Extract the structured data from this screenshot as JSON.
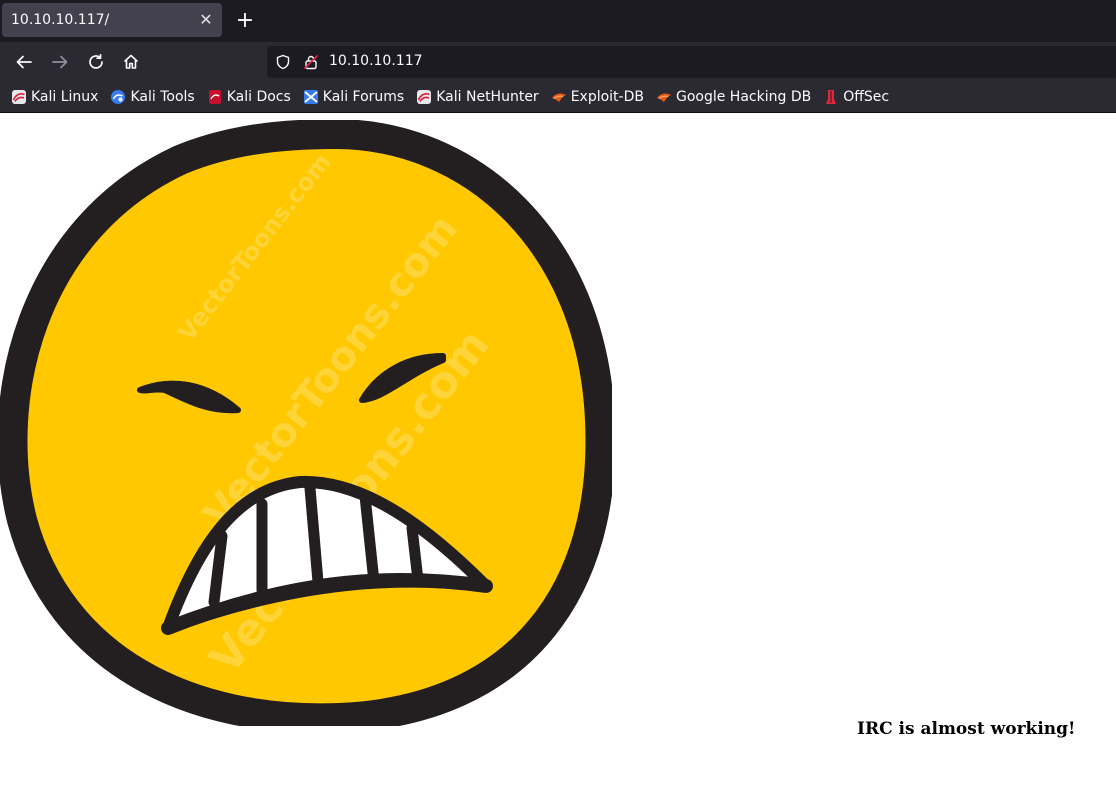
{
  "browser": {
    "tab": {
      "title": "10.10.10.117/",
      "close_icon": "close-icon"
    },
    "new_tab_icon": "plus-icon",
    "nav": {
      "back_icon": "back-arrow-icon",
      "forward_icon": "forward-arrow-icon",
      "reload_icon": "reload-icon",
      "home_icon": "home-icon"
    },
    "url": "10.10.10.117"
  },
  "bookmarks": [
    {
      "label": "Kali Linux",
      "icon": "kali-icon"
    },
    {
      "label": "Kali Tools",
      "icon": "kali-tools-icon"
    },
    {
      "label": "Kali Docs",
      "icon": "kali-docs-icon"
    },
    {
      "label": "Kali Forums",
      "icon": "kali-forums-icon"
    },
    {
      "label": "Kali NetHunter",
      "icon": "kali-icon"
    },
    {
      "label": "Exploit-DB",
      "icon": "exploit-db-icon"
    },
    {
      "label": "Google Hacking DB",
      "icon": "exploit-db-icon"
    },
    {
      "label": "OffSec",
      "icon": "offsec-icon"
    }
  ],
  "page": {
    "image_watermark": "VectorToons.com",
    "message": "IRC is almost working!"
  },
  "colors": {
    "tabstrip": "#1c1b22",
    "toolbar": "#2b2a33",
    "emoji_face": "#ffc800",
    "emoji_outline": "#231f20"
  }
}
